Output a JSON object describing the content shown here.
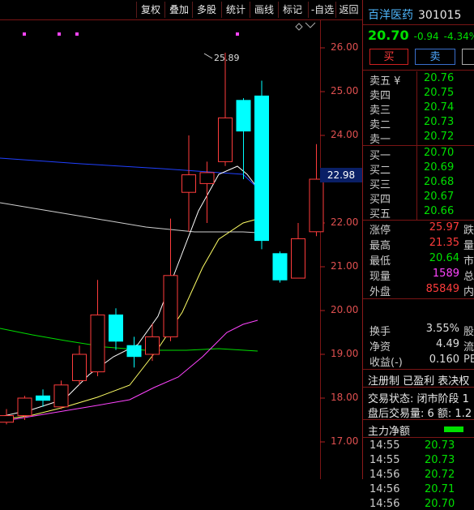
{
  "toolbar": {
    "buttons": [
      "复权",
      "叠加",
      "多股",
      "统计",
      "画线",
      "标记",
      "-自选",
      "返回"
    ]
  },
  "chart": {
    "y_ticks": [
      "26.00",
      "25.00",
      "24.00",
      "23.00",
      "22.00",
      "21.00",
      "20.00",
      "19.00",
      "18.00",
      "17.00"
    ],
    "current_price_tag": "22.98",
    "high_annotation": "25.89",
    "colors": {
      "up": "#ff3c3c",
      "down": "#00ffff",
      "ma5": "#ffffff",
      "ma10": "#ffff66",
      "ma20": "#ff44ff",
      "ma30": "#00dd00",
      "ma60": "#d0d0d0",
      "ma120": "#2040ff"
    }
  },
  "chart_data": {
    "type": "candlestick",
    "ylim": [
      16.9,
      26.4
    ],
    "candles": [
      {
        "o": 17.45,
        "c": 17.6,
        "h": 17.75,
        "l": 17.4
      },
      {
        "o": 17.6,
        "c": 18.0,
        "h": 18.05,
        "l": 17.5
      },
      {
        "o": 18.05,
        "c": 17.95,
        "h": 18.2,
        "l": 17.8
      },
      {
        "o": 17.8,
        "c": 18.3,
        "h": 18.4,
        "l": 17.75
      },
      {
        "o": 18.4,
        "c": 19.0,
        "h": 19.2,
        "l": 18.3
      },
      {
        "o": 18.6,
        "c": 19.9,
        "h": 20.7,
        "l": 18.5
      },
      {
        "o": 19.9,
        "c": 19.3,
        "h": 20.05,
        "l": 19.1
      },
      {
        "o": 19.2,
        "c": 18.95,
        "h": 19.4,
        "l": 18.7
      },
      {
        "o": 19.0,
        "c": 19.4,
        "h": 19.7,
        "l": 18.85
      },
      {
        "o": 19.4,
        "c": 20.8,
        "h": 22.1,
        "l": 19.3
      },
      {
        "o": 22.7,
        "c": 23.1,
        "h": 24.0,
        "l": 21.8
      },
      {
        "o": 22.9,
        "c": 23.15,
        "h": 23.4,
        "l": 22.0
      },
      {
        "o": 23.4,
        "c": 24.4,
        "h": 25.89,
        "l": 23.3
      },
      {
        "o": 24.8,
        "c": 24.1,
        "h": 24.85,
        "l": 23.0
      },
      {
        "o": 24.9,
        "c": 21.6,
        "h": 25.25,
        "l": 21.4
      },
      {
        "o": 21.3,
        "c": 20.7,
        "h": 21.35,
        "l": 20.64
      },
      {
        "o": 20.74,
        "c": 21.64,
        "h": 22.0,
        "l": 20.74
      },
      {
        "o": 21.8,
        "c": 23.0,
        "h": 23.8,
        "l": 21.7
      }
    ]
  },
  "stock": {
    "name": "百洋医药",
    "code": "301015",
    "price": "20.70",
    "change": "-0.94",
    "change_pct": "-4.34%"
  },
  "actions": {
    "buy": "买",
    "sell": "卖"
  },
  "asks": [
    {
      "label": "卖五 ¥",
      "price": "20.76"
    },
    {
      "label": "卖四",
      "price": "20.75"
    },
    {
      "label": "卖三",
      "price": "20.74"
    },
    {
      "label": "卖二",
      "price": "20.73"
    },
    {
      "label": "卖一",
      "price": "20.72"
    }
  ],
  "bids": [
    {
      "label": "买一",
      "price": "20.70"
    },
    {
      "label": "买二",
      "price": "20.69"
    },
    {
      "label": "买三",
      "price": "20.68"
    },
    {
      "label": "买四",
      "price": "20.67"
    },
    {
      "label": "买五",
      "price": "20.66"
    }
  ],
  "stats": [
    {
      "label": "涨停",
      "value": "25.97",
      "color": "#ff3c3c",
      "extra": "跌"
    },
    {
      "label": "最高",
      "value": "21.35",
      "color": "#ff3c3c",
      "extra": "量"
    },
    {
      "label": "最低",
      "value": "20.64",
      "color": "#00e000",
      "extra": "市"
    },
    {
      "label": "现量",
      "value": "1589",
      "color": "#ff44ff",
      "extra": "总"
    },
    {
      "label": "外盘",
      "value": "85849",
      "color": "#ff3c3c",
      "extra": "内"
    }
  ],
  "stats2": [
    {
      "label": "换手",
      "value": "3.55%",
      "color": "#dddddd",
      "extra": "股"
    },
    {
      "label": "净资",
      "value": "4.49",
      "color": "#dddddd",
      "extra": "流"
    },
    {
      "label": "收益(-)",
      "value": "0.160",
      "color": "#dddddd",
      "extra": "PE"
    }
  ],
  "tags": "注册制 已盈利 表决权",
  "trade_status": "交易状态: 闭市阶段 1",
  "after_hours": "盘后交易量: 6  额: 1.2",
  "main_flow": "主力净额",
  "trades": [
    {
      "time": "14:55",
      "price": "20.73"
    },
    {
      "time": "14:55",
      "price": "20.73"
    },
    {
      "time": "14:56",
      "price": "20.72"
    },
    {
      "time": "14:56",
      "price": "20.71"
    },
    {
      "time": "14:56",
      "price": "20.70"
    }
  ]
}
